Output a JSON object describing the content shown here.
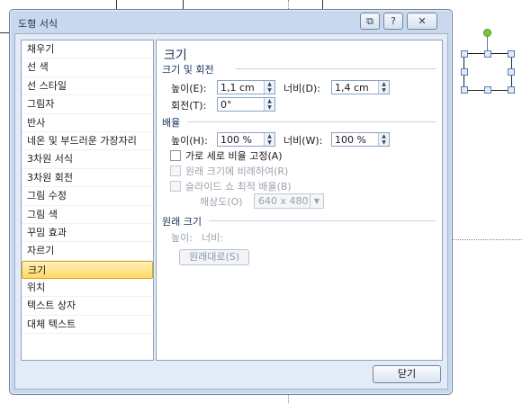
{
  "dialog": {
    "title": "도형 서식",
    "help_label": "?",
    "close_label": "✕",
    "footer_close_label": "닫기"
  },
  "categories": [
    "채우기",
    "선 색",
    "선 스타일",
    "그림자",
    "반사",
    "네온 및 부드러운 가장자리",
    "3차원 서식",
    "3차원 회전",
    "그림 수정",
    "그림 색",
    "꾸밈 효과",
    "자르기",
    "크기",
    "위치",
    "텍스트 상자",
    "대체 텍스트"
  ],
  "selected_category": "크기",
  "panel": {
    "title": "크기",
    "size_rotate": {
      "heading": "크기 및 회전",
      "height_label": "높이(E):",
      "height_value": "1,1 cm",
      "width_label": "너비(D):",
      "width_value": "1,4 cm",
      "rotation_label": "회전(T):",
      "rotation_value": "0°"
    },
    "scale": {
      "heading": "배율",
      "height_label": "높이(H):",
      "height_value": "100 %",
      "width_label": "너비(W):",
      "width_value": "100 %",
      "lock_aspect_label": "가로 세로 비율 고정(A)",
      "lock_aspect_checked": false,
      "relative_original_label": "원래 크기에 비례하여(R)",
      "slideshow_best_label": "슬라이드 쇼 최적 배율(B)",
      "resolution_label": "해상도(O)",
      "resolution_value": "640 x 480"
    },
    "original": {
      "heading": "원래 크기",
      "height_label": "높이:",
      "width_label": "너비:",
      "reset_label": "원래대로(S)"
    }
  }
}
